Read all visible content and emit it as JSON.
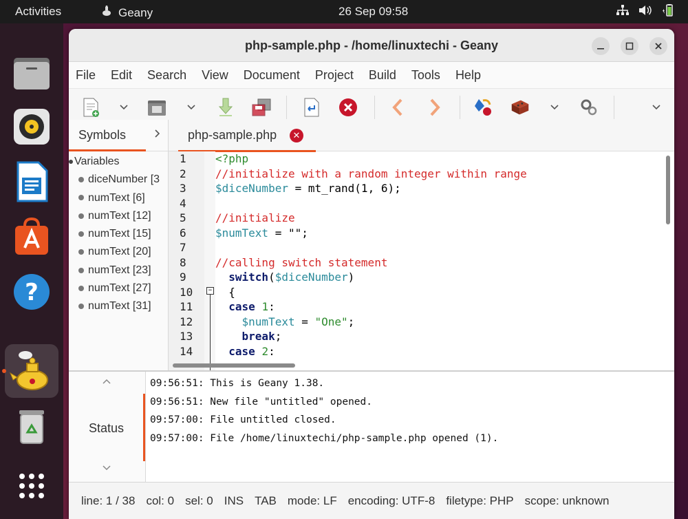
{
  "topbar": {
    "activities": "Activities",
    "app_name": "Geany",
    "clock": "26 Sep  09:58"
  },
  "dock": {
    "items": [
      "files-icon",
      "rhythmbox-icon",
      "writer-icon",
      "app-center-icon",
      "help-icon",
      "geany-icon",
      "trash-icon",
      "show-apps-icon"
    ],
    "active": "geany-icon"
  },
  "window": {
    "title": "php-sample.php - /home/linuxtechi - Geany"
  },
  "menu": [
    "File",
    "Edit",
    "Search",
    "View",
    "Document",
    "Project",
    "Build",
    "Tools",
    "Help"
  ],
  "sidebar": {
    "tab_label": "Symbols",
    "root": "Variables",
    "items": [
      "diceNumber [3",
      "numText [6]",
      "numText [12]",
      "numText [15]",
      "numText [20]",
      "numText [23]",
      "numText [27]",
      "numText [31]"
    ]
  },
  "editor": {
    "tab_label": "php-sample.php",
    "line_numbers": [
      "1",
      "2",
      "3",
      "4",
      "5",
      "6",
      "7",
      "8",
      "9",
      "10",
      "11",
      "12",
      "13",
      "14"
    ],
    "lines": {
      "l1": "<?php",
      "l2": "//initialize with a random integer within range",
      "l3_var": "$diceNumber",
      "l3_rest": " = mt_rand(1, 6);",
      "l5": "//initialize",
      "l6_var": "$numText",
      "l6_rest": " = \"\";",
      "l8": "//calling switch statement",
      "l9_kw": "switch",
      "l9_var": "$diceNumber",
      "l10": "{",
      "l11_kw": "case",
      "l11_num": "1",
      "l12_var": "$numText",
      "l12_str": "\"One\"",
      "l13_kw": "break",
      "l14_kw": "case",
      "l14_num": "2"
    }
  },
  "messages": {
    "panel_label": "Status",
    "rows": [
      "09:56:51: This is Geany 1.38.",
      "09:56:51: New file \"untitled\" opened.",
      "09:57:00: File untitled closed.",
      "09:57:00: File /home/linuxtechi/php-sample.php opened (1)."
    ]
  },
  "statusbar": {
    "line": "line: 1 / 38",
    "col": "col: 0",
    "sel": "sel: 0",
    "ins": "INS",
    "tab": "TAB",
    "mode": "mode: LF",
    "encoding": "encoding: UTF-8",
    "filetype": "filetype: PHP",
    "scope": "scope: unknown"
  }
}
